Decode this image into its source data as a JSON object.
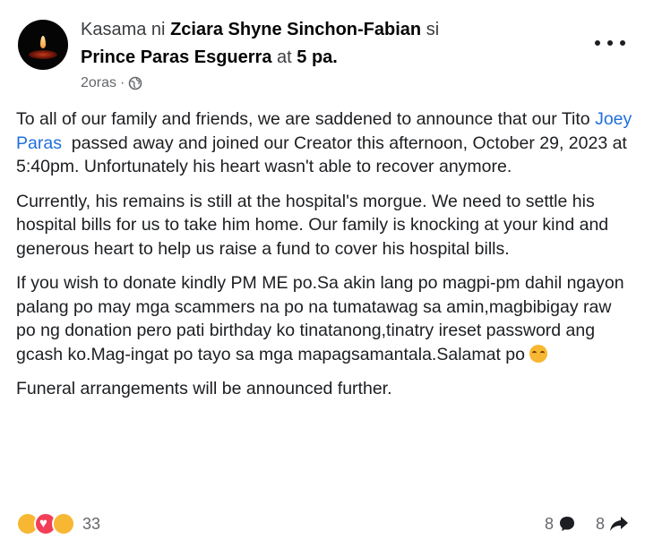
{
  "post": {
    "header": {
      "prefix": "Kasama ni",
      "tagged_1": "Zciara Shyne Sinchon-Fabian",
      "connector_1": "si",
      "tagged_2": "Prince Paras Esguerra",
      "connector_2": "at",
      "tagged_3": "5 pa."
    },
    "time": "2oras",
    "separator": "·",
    "body": {
      "p1_before": "To all of our family and friends, we are saddened to announce that our Tito ",
      "p1_mention": "Joey Paras",
      "p1_after": "  passed away and joined our Creator this afternoon, October 29, 2023 at 5:40pm. Unfortunately his heart wasn't able to recover anymore.",
      "p2": "Currently, his remains is still at the hospital's morgue. We need to settle his hospital bills for us to take him home. Our family is knocking at your kind and generous heart to help us raise a fund to cover his hospital bills.",
      "p3": "If you wish to donate kindly PM ME po.Sa akin lang po magpi-pm dahil ngayon palang po may mga scammers na po na tumatawag sa amin,magbibigay raw po ng donation pero pati birthday ko tinatanong,tinatry ireset password ang gcash ko.Mag-ingat po tayo sa mga mapagsamantala.Salamat po",
      "p4": "Funeral arrangements will be announced further."
    },
    "footer": {
      "reaction_count": "33",
      "comment_count": "8",
      "share_count": "8"
    },
    "icons": {
      "more": "more-options-icon",
      "audience": "globe-icon",
      "comment": "comment-icon",
      "share": "share-icon"
    },
    "colors": {
      "mention": "#216fdb",
      "secondary_text": "#65676b"
    }
  }
}
